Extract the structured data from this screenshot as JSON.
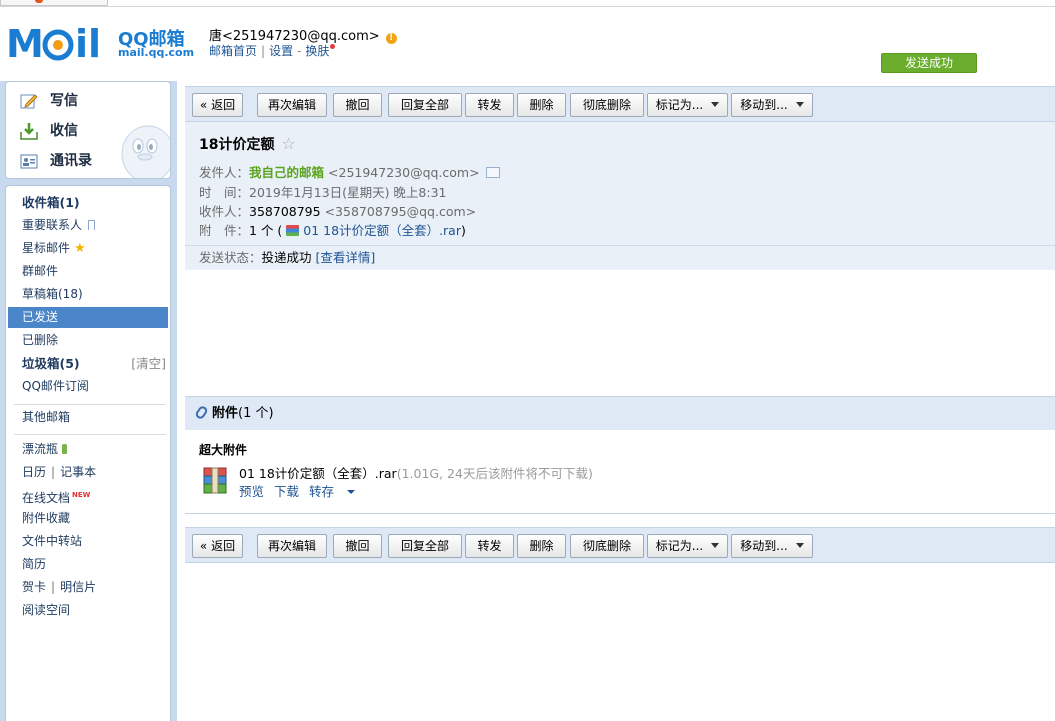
{
  "header": {
    "logo_text": "MOil",
    "logo_brand": "QQ邮箱",
    "logo_url": "mail.qq.com",
    "user": "唐<251947230@qq.com>",
    "warn_icon": "!",
    "links": [
      "邮箱首页",
      "设置",
      "换肤"
    ],
    "link_sep": "|",
    "link_dash": "-",
    "send_success": "发送成功"
  },
  "quick": {
    "compose": "写信",
    "inbox": "收信",
    "contacts": "通讯录"
  },
  "folders": {
    "inbox": "收件箱(1)",
    "important": "重要联系人",
    "starred": "星标邮件",
    "group": "群邮件",
    "drafts": "草稿箱(18)",
    "sent": "已发送",
    "deleted": "已删除",
    "junk": "垃圾箱(5)",
    "junk_clear": "[清空]",
    "subscribe": "QQ邮件订阅",
    "other": "其他邮箱",
    "drift": "漂流瓶",
    "calendar": "日历",
    "notes": "记事本",
    "docs": "在线文档",
    "docs_new": "NEW",
    "attach_fav": "附件收藏",
    "transfer": "文件中转站",
    "resume": "简历",
    "card": "贺卡",
    "postcard": "明信片",
    "reading": "阅读空间",
    "pipe": "|"
  },
  "toolbar": {
    "back": "« 返回",
    "reedit": "再次编辑",
    "recall": "撤回",
    "reply_all": "回复全部",
    "forward": "转发",
    "delete": "删除",
    "delete_perm": "彻底删除",
    "mark_as": "标记为...",
    "move_to": "移动到..."
  },
  "mail": {
    "subject": "18计价定额",
    "fav_star": "☆",
    "from_label": "发件人：",
    "from_name": "我自己的邮箱",
    "from_addr": "<251947230@qq.com>",
    "time_label": "时　间：",
    "time_value": "2019年1月13日(星期天) 晚上8:31",
    "to_label": "收件人：",
    "to_name": "358708795",
    "to_addr": "<358708795@qq.com>",
    "att_label": "附　件：",
    "att_count": "1 个 (",
    "att_name": "01 18计价定额（全套）.rar",
    "att_close": ")",
    "status_label": "发送状态：",
    "status_value": "投递成功",
    "status_link": "[查看详情]"
  },
  "attachments": {
    "title": "附件",
    "count": "(1 个)",
    "big_title": "超大附件",
    "file_name": "01 18计价定额（全套）.rar",
    "file_note": "(1.01G, 24天后该附件将不可下载)",
    "preview": "预览",
    "download": "下载",
    "save": "转存"
  }
}
